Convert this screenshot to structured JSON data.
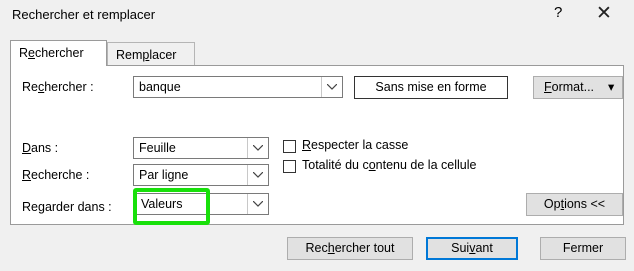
{
  "window": {
    "title": "Rechercher et remplacer",
    "help": "?",
    "close": "✕"
  },
  "tabs": [
    {
      "pre": "R",
      "u": "e",
      "post": "chercher"
    },
    {
      "pre": "Rem",
      "u": "p",
      "post": "lacer"
    }
  ],
  "find": {
    "label_pre": "Re",
    "label_u": "c",
    "label_post": "hercher :",
    "value": "banque",
    "no_format": "Sans mise en forme",
    "format_u": "F",
    "format_post": "ormat...",
    "format_arrow": "▾"
  },
  "within": {
    "label_pre": "",
    "label_u": "D",
    "label_post": "ans :",
    "value": "Feuille"
  },
  "search": {
    "label_pre": "",
    "label_u": "R",
    "label_post": "echerche :",
    "value": "Par ligne"
  },
  "lookin": {
    "label_pre": "Re",
    "label_u": "g",
    "label_post": "arder dans :",
    "value": "Valeurs",
    "highlight_color": "#18e00a"
  },
  "options": {
    "match_case": {
      "pre": "",
      "u": "R",
      "post": "especter la casse",
      "checked": false
    },
    "entire_cell": {
      "pre": "Totalité du c",
      "u": "o",
      "post": "ntenu de la cellule",
      "checked": false
    },
    "button": {
      "pre": "Op",
      "u": "t",
      "post": "ions <<"
    }
  },
  "actions": {
    "find_all": {
      "pre": "Rec",
      "u": "h",
      "post": "ercher tout"
    },
    "find_next": {
      "pre": "Sui",
      "u": "v",
      "post": "ant"
    },
    "close": "Fermer"
  }
}
